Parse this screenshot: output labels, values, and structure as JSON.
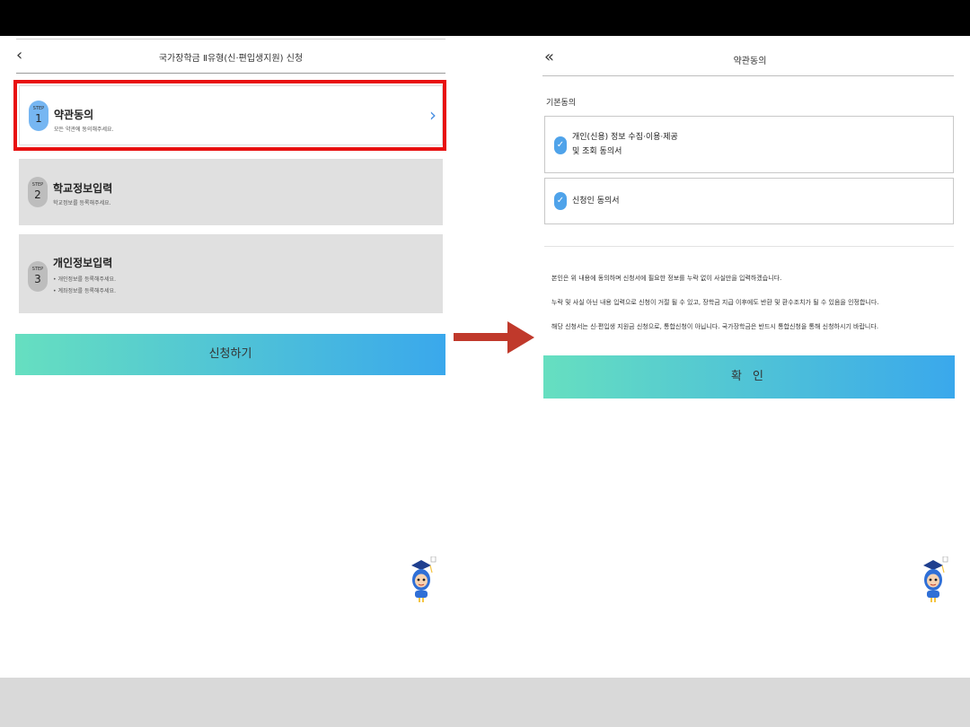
{
  "left": {
    "title": "국가장학금 Ⅱ유형(신·편입생지원) 신청",
    "steps": [
      {
        "step_label": "STEP",
        "number": "1",
        "title": "약관동의",
        "desc": "모든 약관에 동의해주세요."
      },
      {
        "step_label": "STEP",
        "number": "2",
        "title": "학교정보입력",
        "desc": "학교정보를 등록해주세요."
      },
      {
        "step_label": "STEP",
        "number": "3",
        "title": "개인정보입력",
        "desc1": "• 개인정보를 등록해주세요.",
        "desc2": "• 계좌정보를 등록해주세요."
      }
    ],
    "apply_label": "신청하기"
  },
  "right": {
    "title": "약관동의",
    "section": "기본동의",
    "agree1_line1": "개인(신용) 정보 수집·이용·제공",
    "agree1_line2": "및 조회 동의서",
    "agree2": "신청인 동의서",
    "notice1": "본인은 위 내용에 동의하며 신청서에 필요한 정보를 누락 없이 사실만을 입력하겠습니다.",
    "notice2": "누락 및 사실 아닌 내용 입력으로 신청이 거절 될 수 있고, 장학금 지급 이후에도 반환 및 환수조치가 될 수 있음을 인정합니다.",
    "notice3": "해당 신청서는 신·편입생 지원금 신청으로, 통합신청이 아닙니다. 국가장학금은 반드시 통합신청을 통해 신청하시기 바랍니다.",
    "confirm_label": "확 인"
  },
  "colors": {
    "highlight": "#e81010",
    "arrow": "#c0392b",
    "gradient_start": "#66dfc0",
    "gradient_end": "#3aa8ec",
    "step_active": "#76b6f2"
  },
  "icons": [
    "back-chevron-icon",
    "double-back-chevron-icon",
    "chevron-right-icon",
    "check-icon",
    "mascot-icon",
    "arrow-right-icon"
  ]
}
